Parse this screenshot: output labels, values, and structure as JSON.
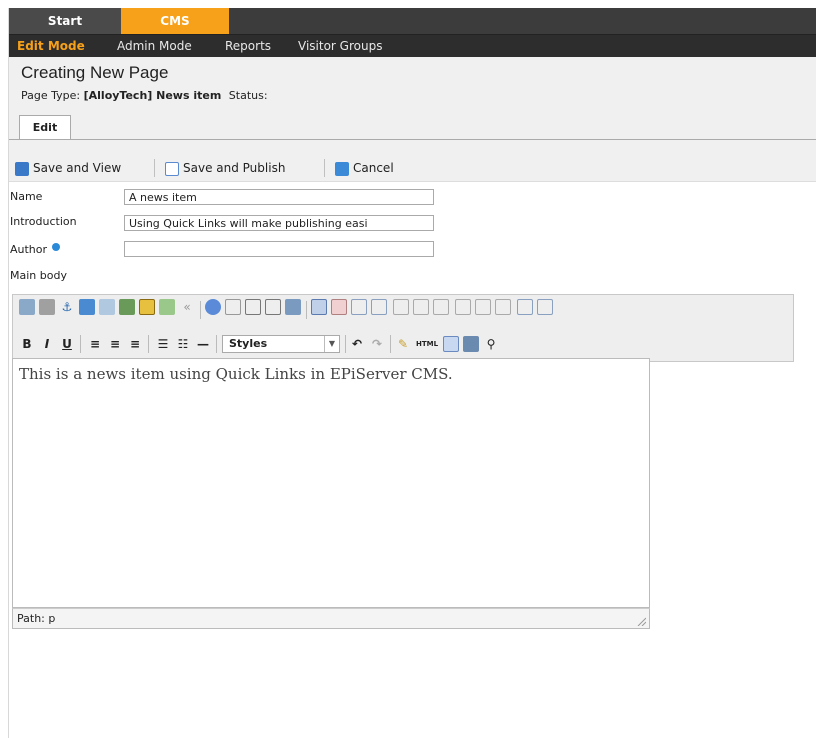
{
  "top_tabs": [
    {
      "label": "Start"
    },
    {
      "label": "CMS"
    }
  ],
  "sub_nav": [
    {
      "label": "Edit Mode"
    },
    {
      "label": "Admin Mode"
    },
    {
      "label": "Reports"
    },
    {
      "label": "Visitor Groups"
    }
  ],
  "page": {
    "title": "Creating New Page",
    "type_label": "Page Type:",
    "type_value": "[AlloyTech] News item",
    "status_label": "Status:"
  },
  "edit_tab": {
    "label": "Edit"
  },
  "actions": {
    "save_view": "Save and View",
    "save_publish": "Save and Publish",
    "cancel": "Cancel"
  },
  "form": {
    "name_label": "Name",
    "name_value": "A news item",
    "intro_label": "Introduction",
    "intro_value": "Using Quick Links will make publishing easi",
    "author_label": "Author",
    "author_value": "",
    "mainbody_label": "Main body"
  },
  "editor": {
    "styles_value": "Styles",
    "html_label": "HTML",
    "bold": "B",
    "italic": "I",
    "underline": "U",
    "content": "This is a news item using Quick Links in EPiServer CMS.",
    "path_label": "Path: p"
  },
  "colors": {
    "accent": "#f7a11b",
    "topbar": "#3c3c3c",
    "subbar": "#2d2d2d"
  }
}
